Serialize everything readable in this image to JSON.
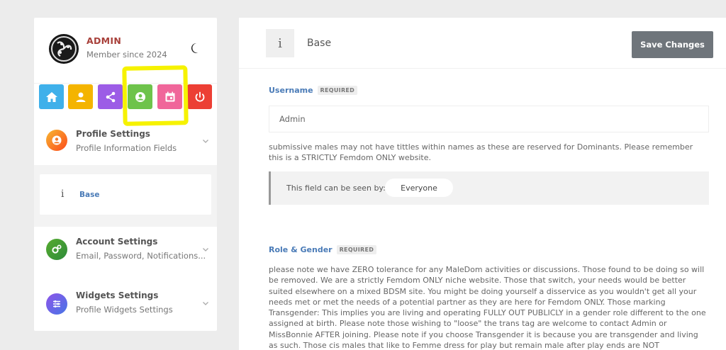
{
  "user": {
    "name": "ADMIN",
    "since": "Member since 2024"
  },
  "icons": {
    "avatar": "triskele-avatar",
    "theme": "moon-icon",
    "quick": [
      "home-icon",
      "profile-icon",
      "share-icon",
      "account-circle-icon",
      "calendar-icon",
      "power-icon"
    ]
  },
  "colors": {
    "quick": [
      "#3fb0ea",
      "#f4b400",
      "#9c5ce6",
      "#6ec34b",
      "#f0669a",
      "#ec3f34"
    ],
    "highlight": "#f6f200",
    "accent_blue": "#4a7bb7",
    "admin_red": "#a8403a"
  },
  "sidebar": {
    "profile": {
      "title": "Profile Settings",
      "subtitle": "Profile Information Fields"
    },
    "base_item": {
      "icon": "i",
      "label": "Base"
    },
    "account": {
      "title": "Account Settings",
      "subtitle": "Email, Password, Notifications..."
    },
    "widgets": {
      "title": "Widgets Settings",
      "subtitle": "Profile Widgets Settings"
    }
  },
  "main": {
    "header_icon": "i",
    "title": "Base",
    "save_label": "Save Changes",
    "username": {
      "label": "Username",
      "required": "REQUIRED",
      "value": "Admin",
      "description": "submissive males may not have tittles within names as these are reserved for Dominants. Please remember this is a STRICTLY Femdom ONLY website.",
      "visibility_text": "This field can be seen by:",
      "visibility_value": "Everyone"
    },
    "role_gender": {
      "label": "Role & Gender",
      "required": "REQUIRED",
      "description": "please note we have ZERO tolerance for any MaleDom activities or discussions. Those found to be doing so will be removed. We are a strictly Femdom ONLY niche website. Those that switch, your needs would be better suited elsewhere on a mixed BDSM site. You might be doing yourself a disservice as you wouldn't get all your needs met or met the needs of a potential partner as they are here for Femdom ONLY. Those marking Transgender: This implies you are living and operating FULLY OUT PUBLICLY in a gender role different to the one assigned at birth. Please note those wishing to \"loose\" the trans tag are welcome to contact Admin or MissBonnie AFTER joining. Please note if you choose Transgender it is because you are transgender and living as such. Those cis males that like to Femme dress for play but remain male after play ends are NOT transgender, you are a sissy or cross dresser (or possible fluid gender)_. Being"
    }
  }
}
